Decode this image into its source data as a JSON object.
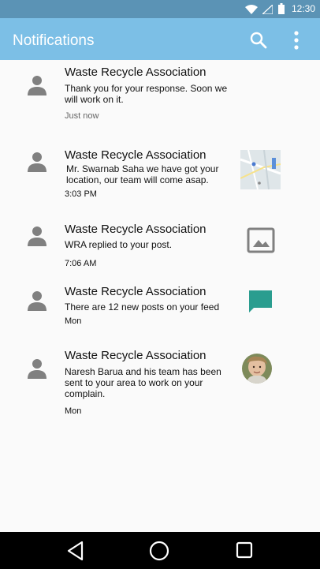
{
  "status_bar": {
    "time": "12:30",
    "icons": [
      "wifi-icon",
      "signal-icon",
      "battery-icon"
    ]
  },
  "app_bar": {
    "title": "Notifications",
    "icons": [
      "search-icon",
      "more-vert-icon"
    ]
  },
  "notifications": [
    {
      "sender": "Waste Recycle Association",
      "message": "Thank you for your response. Soon we will work on it.",
      "time": "Just now",
      "thumbnail": "none"
    },
    {
      "sender": "Waste Recycle Association",
      "message": "Mr. Swarnab Saha we have got your location, our team will come asap.",
      "time": "3:03 PM",
      "thumbnail": "map-thumbnail"
    },
    {
      "sender": "Waste Recycle Association",
      "message": "WRA replied to your post.",
      "time": "7:06 AM",
      "thumbnail": "image-icon"
    },
    {
      "sender": "Waste Recycle Association",
      "message": "There are 12 new posts on your feed",
      "time": "Mon",
      "thumbnail": "chat-icon"
    },
    {
      "sender": "Waste Recycle Association",
      "message": "Naresh Barua and his team has been sent to your area to work on your complain.",
      "time": "Mon",
      "thumbnail": "user-photo"
    }
  ],
  "colors": {
    "app_bar": "#7cbfe6",
    "status_bar": "#5b93b5",
    "chat_icon": "#2a9d8f"
  },
  "nav_bar": {
    "icons": [
      "back-icon",
      "home-icon",
      "recents-icon"
    ]
  }
}
